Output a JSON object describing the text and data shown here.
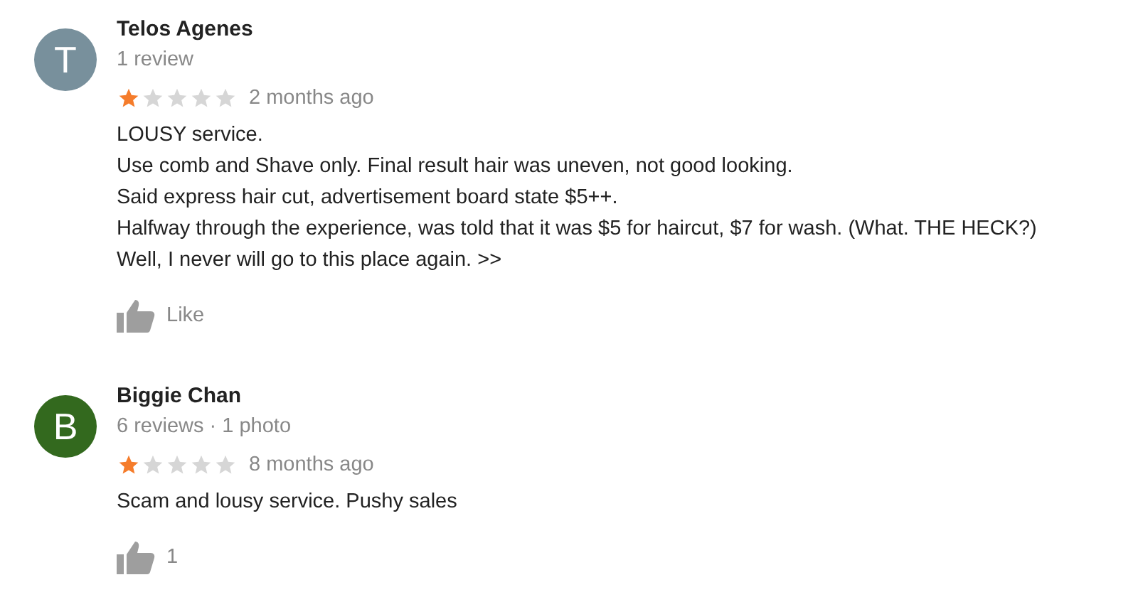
{
  "reviews": [
    {
      "avatar": {
        "letter": "T",
        "color": "#78909c"
      },
      "name": "Telos Agenes",
      "meta": "1 review",
      "stars": 1,
      "time": "2 months ago",
      "lines": [
        "LOUSY service.",
        "Use comb and Shave only. Final result hair was uneven, not good looking.",
        "Said express hair cut, advertisement board state $5++.",
        "Halfway through the experience, was told that it was $5 for haircut, $7 for wash. (What. THE HECK?)",
        "Well, I never will go to this place again. >>"
      ],
      "like": "Like"
    },
    {
      "avatar": {
        "letter": "B",
        "color": "#33691e"
      },
      "name": "Biggie Chan",
      "meta": "6 reviews · 1 photo",
      "stars": 1,
      "time": "8 months ago",
      "lines": [
        "Scam and lousy service. Pushy sales"
      ],
      "like": "1"
    }
  ]
}
